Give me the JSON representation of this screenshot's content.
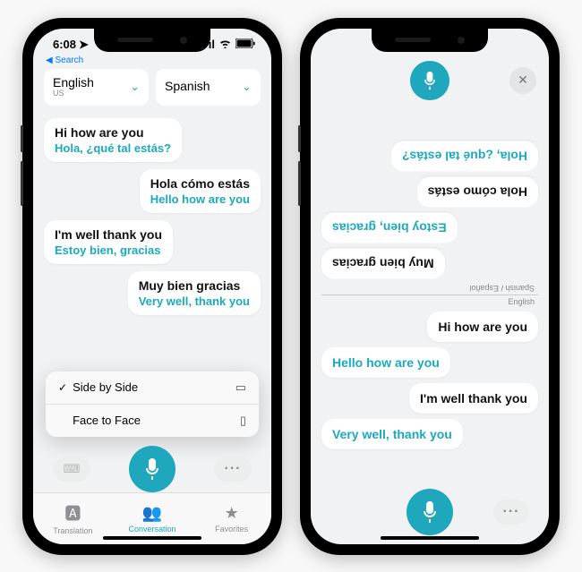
{
  "status": {
    "time": "6:08",
    "back": "Search"
  },
  "lang": {
    "left": {
      "main": "English",
      "sub": "US"
    },
    "right": {
      "main": "Spanish",
      "sub": ""
    }
  },
  "conversation": [
    {
      "side": "left",
      "orig": "Hi how are you",
      "trans": "Hola, ¿qué tal estás?"
    },
    {
      "side": "right",
      "orig": "Hola cómo estás",
      "trans": "Hello how are you"
    },
    {
      "side": "left",
      "orig": "I'm well thank you",
      "trans": "Estoy bien, gracias"
    },
    {
      "side": "right",
      "orig": "Muy bien gracias",
      "trans": "Very well, thank you"
    }
  ],
  "menu": {
    "item1": "Side by Side",
    "item2": "Face to Face"
  },
  "tabs": {
    "t1": "Translation",
    "t2": "Conversation",
    "t3": "Favorites"
  },
  "f2f": {
    "topLabel": "Spanish / Español",
    "bottomLabel": "English",
    "top": [
      {
        "text": "Muy bien gracias",
        "cls": "right"
      },
      {
        "text": "Estoy bien, gracias",
        "cls": "right trans"
      },
      {
        "text": "Hola cómo estás",
        "cls": "left"
      },
      {
        "text": "Hola, ¿qué tal estás?",
        "cls": "left trans"
      }
    ],
    "bottom": [
      {
        "text": "Hi how are you",
        "cls": "right"
      },
      {
        "text": "Hello how are you",
        "cls": "left trans"
      },
      {
        "text": "I'm well thank you",
        "cls": "right"
      },
      {
        "text": "Very well, thank you",
        "cls": "left trans"
      }
    ]
  }
}
